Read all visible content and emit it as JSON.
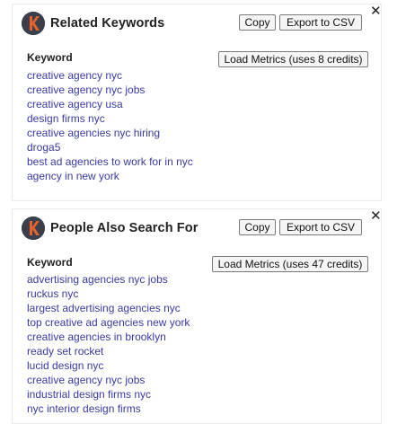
{
  "related": {
    "title": "Related Keywords",
    "copy_label": "Copy",
    "export_label": "Export to CSV",
    "close_label": "✕",
    "column_header": "Keyword",
    "load_metrics_label": "Load Metrics (uses 8 credits)",
    "keywords": [
      "creative agency nyc",
      "creative agency nyc jobs",
      "creative agency usa",
      "design firms nyc",
      "creative agencies nyc hiring",
      "droga5",
      "best ad agencies to work for in nyc",
      "agency in new york"
    ]
  },
  "pasf": {
    "title": "People Also Search For",
    "copy_label": "Copy",
    "export_label": "Export to CSV",
    "close_label": "✕",
    "column_header": "Keyword",
    "load_metrics_label": "Load Metrics (uses 47 credits)",
    "keywords": [
      "advertising agencies nyc jobs",
      "ruckus nyc",
      "largest advertising agencies nyc",
      "top creative ad agencies new york",
      "creative agencies in brooklyn",
      "ready set rocket",
      "lucid design nyc",
      "creative agency nyc jobs",
      "industrial design firms nyc",
      "nyc interior design firms"
    ]
  },
  "colors": {
    "link": "#3a3aa6",
    "logo_bg": "#3a3f4b",
    "logo_accent": "#e8622c"
  },
  "icons": {
    "logo": "keywords-everywhere-logo-icon",
    "close": "close-icon"
  }
}
